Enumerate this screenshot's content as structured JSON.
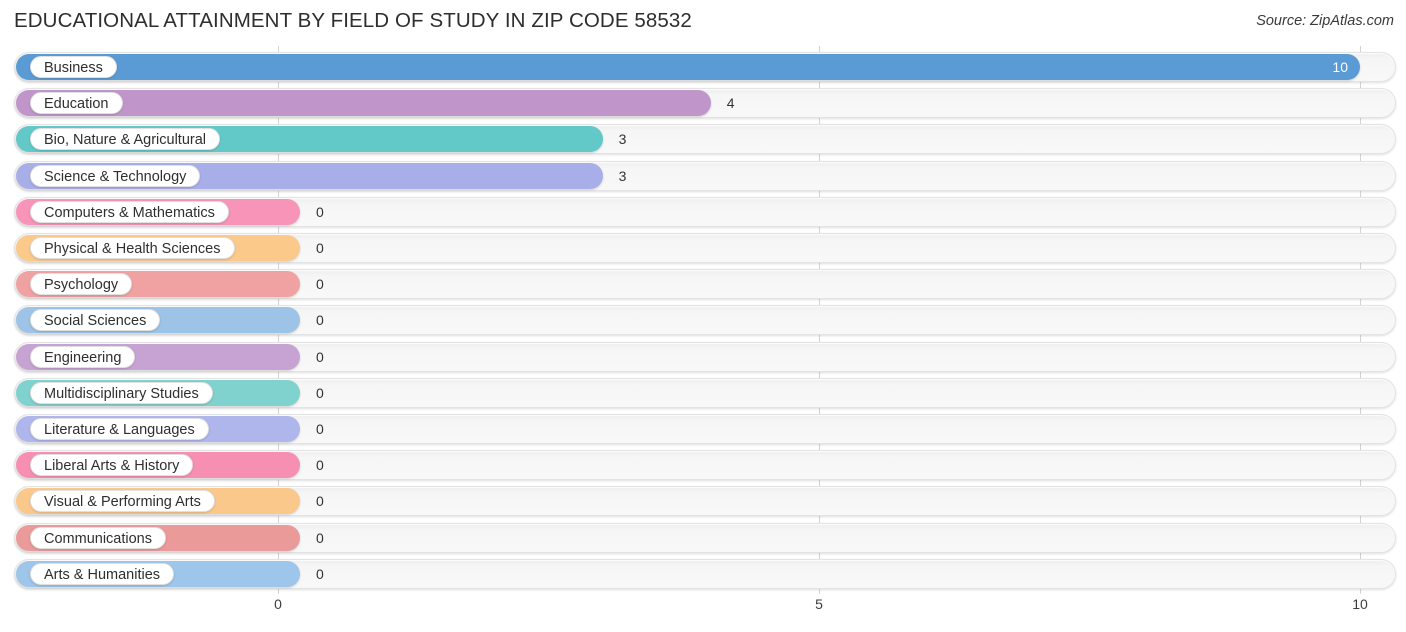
{
  "header": {
    "title": "EDUCATIONAL ATTAINMENT BY FIELD OF STUDY IN ZIP CODE 58532",
    "source": "Source: ZipAtlas.com"
  },
  "chart_data": {
    "type": "bar",
    "orientation": "horizontal",
    "title": "EDUCATIONAL ATTAINMENT BY FIELD OF STUDY IN ZIP CODE 58532",
    "subtitle": "",
    "xlabel": "",
    "ylabel": "",
    "xlim": [
      0,
      10
    ],
    "grid": true,
    "legend": null,
    "xticks": [
      {
        "value": 0,
        "label": "0"
      },
      {
        "value": 5,
        "label": "5"
      },
      {
        "value": 10,
        "label": "10"
      }
    ],
    "categories": [
      "Business",
      "Education",
      "Bio, Nature & Agricultural",
      "Science & Technology",
      "Computers & Mathematics",
      "Physical & Health Sciences",
      "Psychology",
      "Social Sciences",
      "Engineering",
      "Multidisciplinary Studies",
      "Literature & Languages",
      "Liberal Arts & History",
      "Visual & Performing Arts",
      "Communications",
      "Arts & Humanities"
    ],
    "values": [
      10,
      4,
      3,
      3,
      0,
      0,
      0,
      0,
      0,
      0,
      0,
      0,
      0,
      0,
      0
    ],
    "value_labels": [
      "10",
      "4",
      "3",
      "3",
      "0",
      "0",
      "0",
      "0",
      "0",
      "0",
      "0",
      "0",
      "0",
      "0",
      "0"
    ],
    "colors": [
      "#5b9bd5",
      "#c096ca",
      "#63c8c8",
      "#a8aee8",
      "#f794b8",
      "#fbc98a",
      "#f0a2a2",
      "#9dc3e6",
      "#c7a3d4",
      "#7fd2cd",
      "#aeb6ec",
      "#f78fb3",
      "#fbc88b",
      "#eb9a9a",
      "#9ec5ea"
    ]
  }
}
